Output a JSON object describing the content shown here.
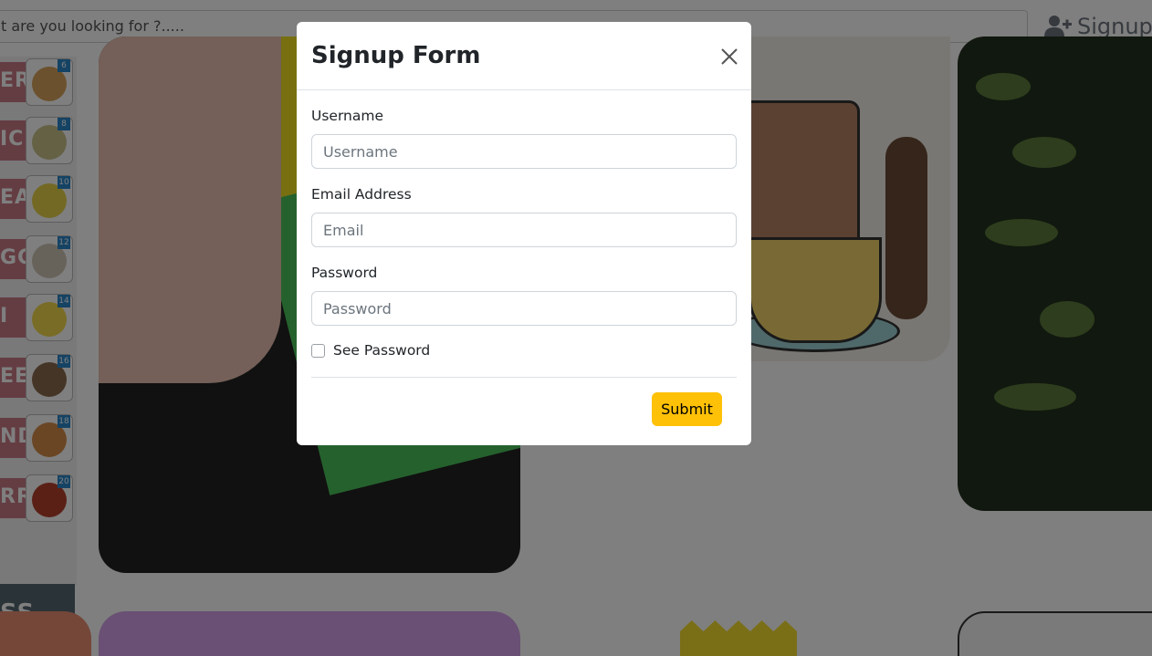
{
  "header": {
    "search_value": "t are you looking for ?.....",
    "signup_label": "Signup",
    "signup_icon": "user-plus-icon"
  },
  "sidebar_foods": [
    {
      "text": "ER",
      "num": "6",
      "dish": "#d9a35c"
    },
    {
      "text": "IC",
      "num": "8",
      "dish": "#c8c28a"
    },
    {
      "text": "EA",
      "num": "10",
      "dish": "#e6d24a"
    },
    {
      "text": "GG",
      "num": "12",
      "dish": "#cfc7b7"
    },
    {
      "text": "I",
      "num": "14",
      "dish": "#f2d94d"
    },
    {
      "text": "EE",
      "num": "16",
      "dish": "#8a6a4c"
    },
    {
      "text": "ND",
      "num": "18",
      "dish": "#d58d4a"
    },
    {
      "text": "RRY",
      "num": "20",
      "dish": "#b5412d"
    }
  ],
  "sidebar_footer": "SS",
  "modal": {
    "title": "Signup Form",
    "close_icon": "close-icon",
    "fields": [
      {
        "label": "Username",
        "placeholder": "Username",
        "value": ""
      },
      {
        "label": "Email Address",
        "placeholder": "Email",
        "value": ""
      },
      {
        "label": "Password",
        "placeholder": "Password",
        "value": ""
      }
    ],
    "see_password_label": "See Password",
    "see_password_checked": false,
    "submit_label": "Submit"
  },
  "colors": {
    "primary_button": "#ffc107",
    "backdrop": "rgba(0,0,0,0.5)",
    "text": "#212529",
    "input_border": "#ced4da"
  }
}
